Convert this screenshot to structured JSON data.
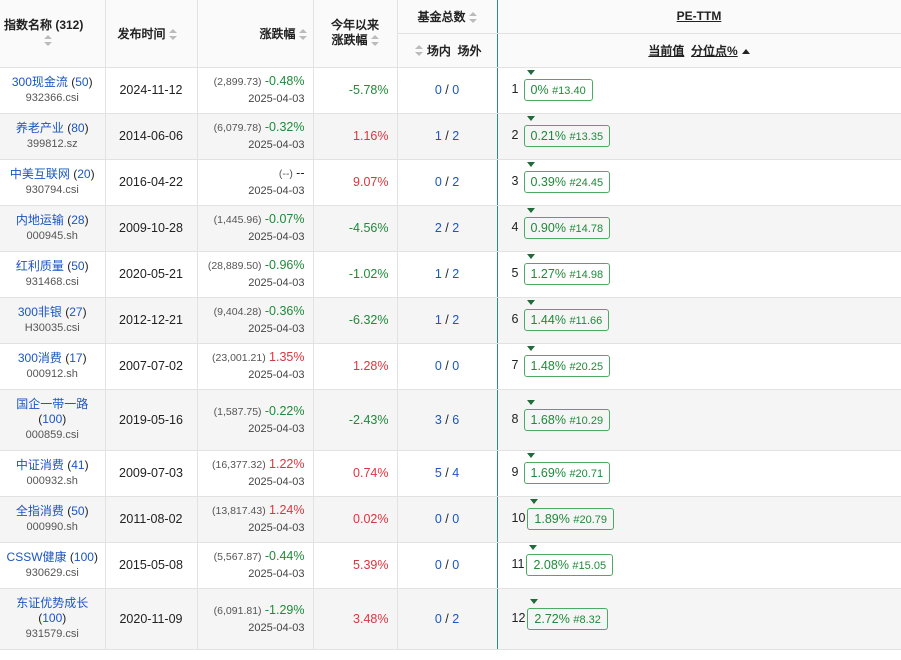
{
  "header": {
    "name": "指数名称 (312)",
    "date": "发布时间",
    "chg": "涨跌幅",
    "ytd_line1": "今年以来",
    "ytd_line2": "涨跌幅",
    "fund": "基金总数",
    "fund_in": "场内",
    "fund_out": "场外",
    "pe": "PE-TTM",
    "pe_current": "当前值",
    "pe_pct": "分位点%"
  },
  "rows": [
    {
      "name": "300现金流",
      "count": "50",
      "code": "932366.csi",
      "date": "2024-11-12",
      "pv": "(2,899.73)",
      "pct": "-0.48%",
      "dir": "neg",
      "sub": "2025-04-03",
      "ytd": "-5.78%",
      "ytd_dir": "neg",
      "fin": "0",
      "fout": "0",
      "rank": "1",
      "pe": "0%",
      "hash": "#13.40"
    },
    {
      "name": "养老产业",
      "count": "80",
      "code": "399812.sz",
      "date": "2014-06-06",
      "pv": "(6,079.78)",
      "pct": "-0.32%",
      "dir": "neg",
      "sub": "2025-04-03",
      "ytd": "1.16%",
      "ytd_dir": "pos",
      "fin": "1",
      "fout": "2",
      "rank": "2",
      "pe": "0.21%",
      "hash": "#13.35"
    },
    {
      "name": "中美互联网",
      "count": "20",
      "code": "930794.csi",
      "date": "2016-04-22",
      "pv": "(--)",
      "pct": "--",
      "dir": "none",
      "sub": "2025-04-03",
      "ytd": "9.07%",
      "ytd_dir": "pos",
      "fin": "0",
      "fout": "2",
      "rank": "3",
      "pe": "0.39%",
      "hash": "#24.45"
    },
    {
      "name": "内地运输",
      "count": "28",
      "code": "000945.sh",
      "date": "2009-10-28",
      "pv": "(1,445.96)",
      "pct": "-0.07%",
      "dir": "neg",
      "sub": "2025-04-03",
      "ytd": "-4.56%",
      "ytd_dir": "neg",
      "fin": "2",
      "fout": "2",
      "rank": "4",
      "pe": "0.90%",
      "hash": "#14.78"
    },
    {
      "name": "红利质量",
      "count": "50",
      "code": "931468.csi",
      "date": "2020-05-21",
      "pv": "(28,889.50)",
      "pct": "-0.96%",
      "dir": "neg",
      "sub": "2025-04-03",
      "ytd": "-1.02%",
      "ytd_dir": "neg",
      "fin": "1",
      "fout": "2",
      "rank": "5",
      "pe": "1.27%",
      "hash": "#14.98"
    },
    {
      "name": "300非银",
      "count": "27",
      "code": "H30035.csi",
      "date": "2012-12-21",
      "pv": "(9,404.28)",
      "pct": "-0.36%",
      "dir": "neg",
      "sub": "2025-04-03",
      "ytd": "-6.32%",
      "ytd_dir": "neg",
      "fin": "1",
      "fout": "2",
      "rank": "6",
      "pe": "1.44%",
      "hash": "#11.66"
    },
    {
      "name": "300消费",
      "count": "17",
      "code": "000912.sh",
      "date": "2007-07-02",
      "pv": "(23,001.21)",
      "pct": "1.35%",
      "dir": "pos",
      "sub": "2025-04-03",
      "ytd": "1.28%",
      "ytd_dir": "pos",
      "fin": "0",
      "fout": "0",
      "rank": "7",
      "pe": "1.48%",
      "hash": "#20.25"
    },
    {
      "name": "国企一带一路",
      "count": "100",
      "code": "000859.csi",
      "date": "2019-05-16",
      "pv": "(1,587.75)",
      "pct": "-0.22%",
      "dir": "neg",
      "sub": "2025-04-03",
      "ytd": "-2.43%",
      "ytd_dir": "neg",
      "fin": "3",
      "fout": "6",
      "rank": "8",
      "pe": "1.68%",
      "hash": "#10.29",
      "wrap": true
    },
    {
      "name": "中证消费",
      "count": "41",
      "code": "000932.sh",
      "date": "2009-07-03",
      "pv": "(16,377.32)",
      "pct": "1.22%",
      "dir": "pos",
      "sub": "2025-04-03",
      "ytd": "0.74%",
      "ytd_dir": "pos",
      "fin": "5",
      "fout": "4",
      "rank": "9",
      "pe": "1.69%",
      "hash": "#20.71"
    },
    {
      "name": "全指消费",
      "count": "50",
      "code": "000990.sh",
      "date": "2011-08-02",
      "pv": "(13,817.43)",
      "pct": "1.24%",
      "dir": "pos",
      "sub": "2025-04-03",
      "ytd": "0.02%",
      "ytd_dir": "pos",
      "fin": "0",
      "fout": "0",
      "rank": "10",
      "pe": "1.89%",
      "hash": "#20.79"
    },
    {
      "name": "CSSW健康",
      "count": "100",
      "code": "930629.csi",
      "date": "2015-05-08",
      "pv": "(5,567.87)",
      "pct": "-0.44%",
      "dir": "neg",
      "sub": "2025-04-03",
      "ytd": "5.39%",
      "ytd_dir": "pos",
      "fin": "0",
      "fout": "0",
      "rank": "11",
      "pe": "2.08%",
      "hash": "#15.05"
    },
    {
      "name": "东证优势成长",
      "count": "100",
      "code": "931579.csi",
      "date": "2020-11-09",
      "pv": "(6,091.81)",
      "pct": "-1.29%",
      "dir": "neg",
      "sub": "2025-04-03",
      "ytd": "3.48%",
      "ytd_dir": "pos",
      "fin": "0",
      "fout": "2",
      "rank": "12",
      "pe": "2.72%",
      "hash": "#8.32",
      "wrap": true
    }
  ]
}
